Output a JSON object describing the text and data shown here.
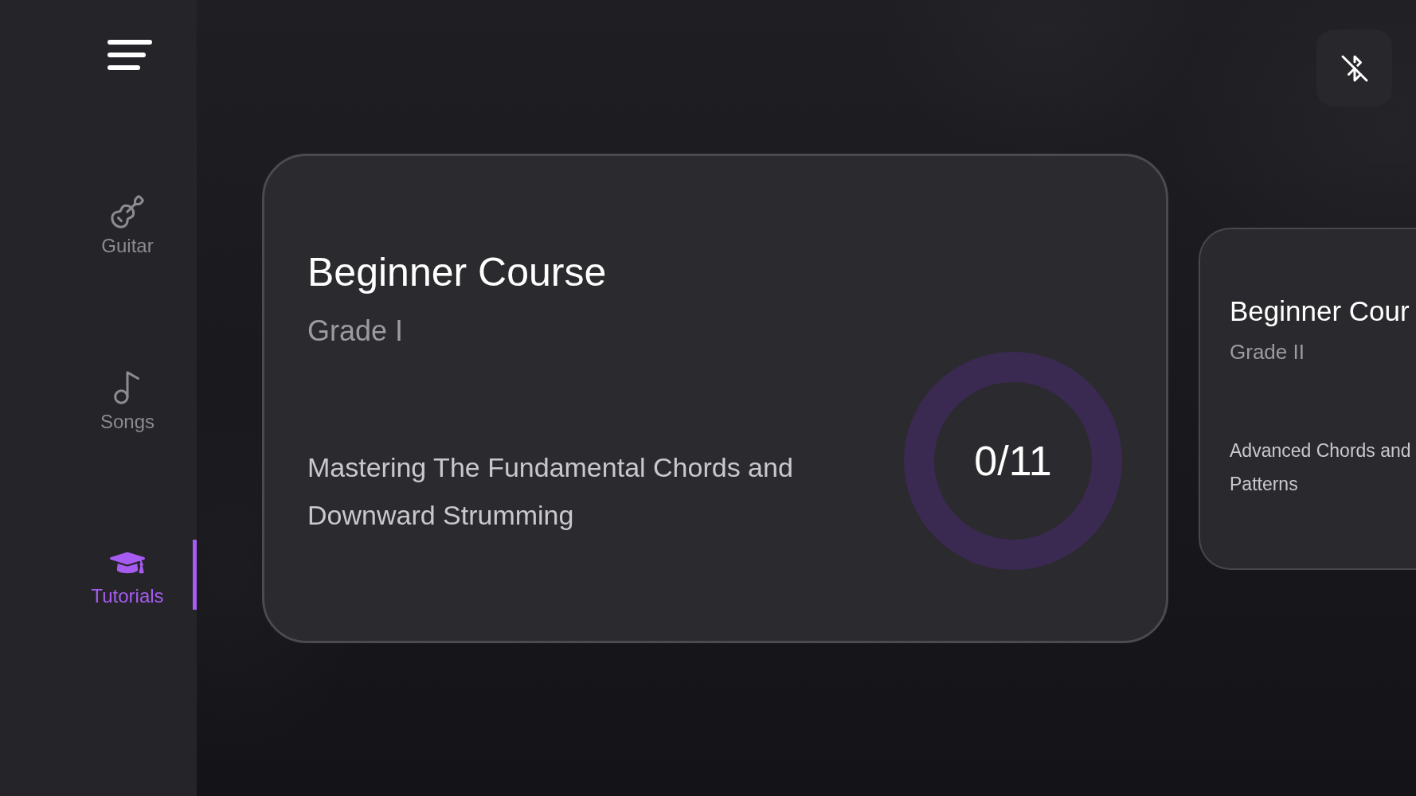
{
  "sidebar": {
    "items": [
      {
        "label": "Guitar",
        "selected": false
      },
      {
        "label": "Songs",
        "selected": false
      },
      {
        "label": "Tutorials",
        "selected": true
      }
    ]
  },
  "bluetooth": {
    "on": false
  },
  "courses": [
    {
      "title": "Beginner Course",
      "grade": "Grade I",
      "description": "Mastering The Fundamental Chords and Downward Strumming",
      "progress": {
        "text": "0/11"
      }
    },
    {
      "title": "Beginner Cour",
      "grade": "Grade II",
      "description": "Advanced Chords and Patterns"
    }
  ]
}
